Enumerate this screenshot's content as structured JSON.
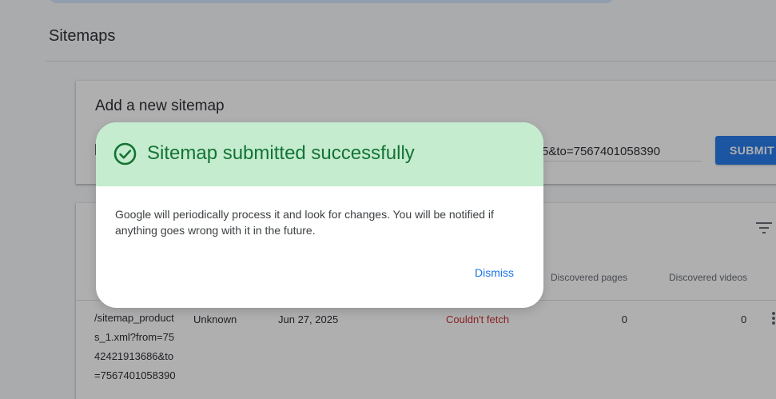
{
  "page": {
    "title": "Sitemaps"
  },
  "add_sitemap": {
    "title": "Add a new sitemap",
    "input_value": "5&to=7567401058390",
    "submit_label": "SUBMIT"
  },
  "table": {
    "headers": {
      "discovered_pages": "Discovered pages",
      "discovered_videos": "Discovered videos"
    },
    "rows": [
      {
        "sitemap": "/sitemap_products_1.xml?from=7542421913686&to=7567401058390",
        "type": "Unknown",
        "submitted": "Jun 27, 2025",
        "status": "Couldn't fetch",
        "discovered_pages": "0",
        "discovered_videos": "0"
      }
    ]
  },
  "dialog": {
    "title": "Sitemap submitted successfully",
    "body": "Google will periodically process it and look for changes. You will be notified if anything goes wrong with it in the future.",
    "dismiss_label": "Dismiss"
  },
  "colors": {
    "dialog_header_bg": "#c5eccf",
    "success_green": "#137333",
    "primary_blue": "#1a73e8",
    "error_red": "#c5221f"
  },
  "icons": {
    "success": "check-circle-icon",
    "filter": "filter-icon",
    "row_menu": "more-vert-icon"
  }
}
